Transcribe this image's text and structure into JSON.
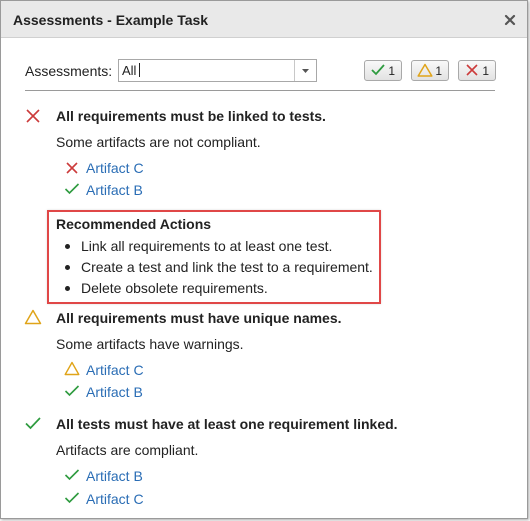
{
  "window": {
    "title": "Assessments - Example Task"
  },
  "filter": {
    "label": "Assessments:",
    "value": "All"
  },
  "counters": {
    "pass": "1",
    "warning": "1",
    "fail": "1"
  },
  "colors": {
    "pass": "#2e9b3f",
    "warning": "#e0a419",
    "fail": "#cc3b3b",
    "link": "#2a6db5",
    "highlight": "#e04747"
  },
  "assessments": [
    {
      "status": "fail",
      "title": "All requirements must be linked to tests.",
      "description": "Some artifacts are not compliant.",
      "artifacts": [
        {
          "status": "fail",
          "name": "Artifact C"
        },
        {
          "status": "pass",
          "name": "Artifact B"
        }
      ],
      "recommended_actions": {
        "title": "Recommended Actions",
        "items": [
          "Link all requirements to at least one test.",
          "Create a test and link the test to a requirement.",
          "Delete obsolete requirements."
        ]
      }
    },
    {
      "status": "warning",
      "title": "All requirements must have unique names.",
      "description": "Some artifacts have warnings.",
      "artifacts": [
        {
          "status": "warning",
          "name": "Artifact C"
        },
        {
          "status": "pass",
          "name": "Artifact B"
        }
      ]
    },
    {
      "status": "pass",
      "title": "All tests must have at least one requirement linked.",
      "description": "Artifacts are compliant.",
      "artifacts": [
        {
          "status": "pass",
          "name": "Artifact B"
        },
        {
          "status": "pass",
          "name": "Artifact C"
        }
      ]
    }
  ]
}
